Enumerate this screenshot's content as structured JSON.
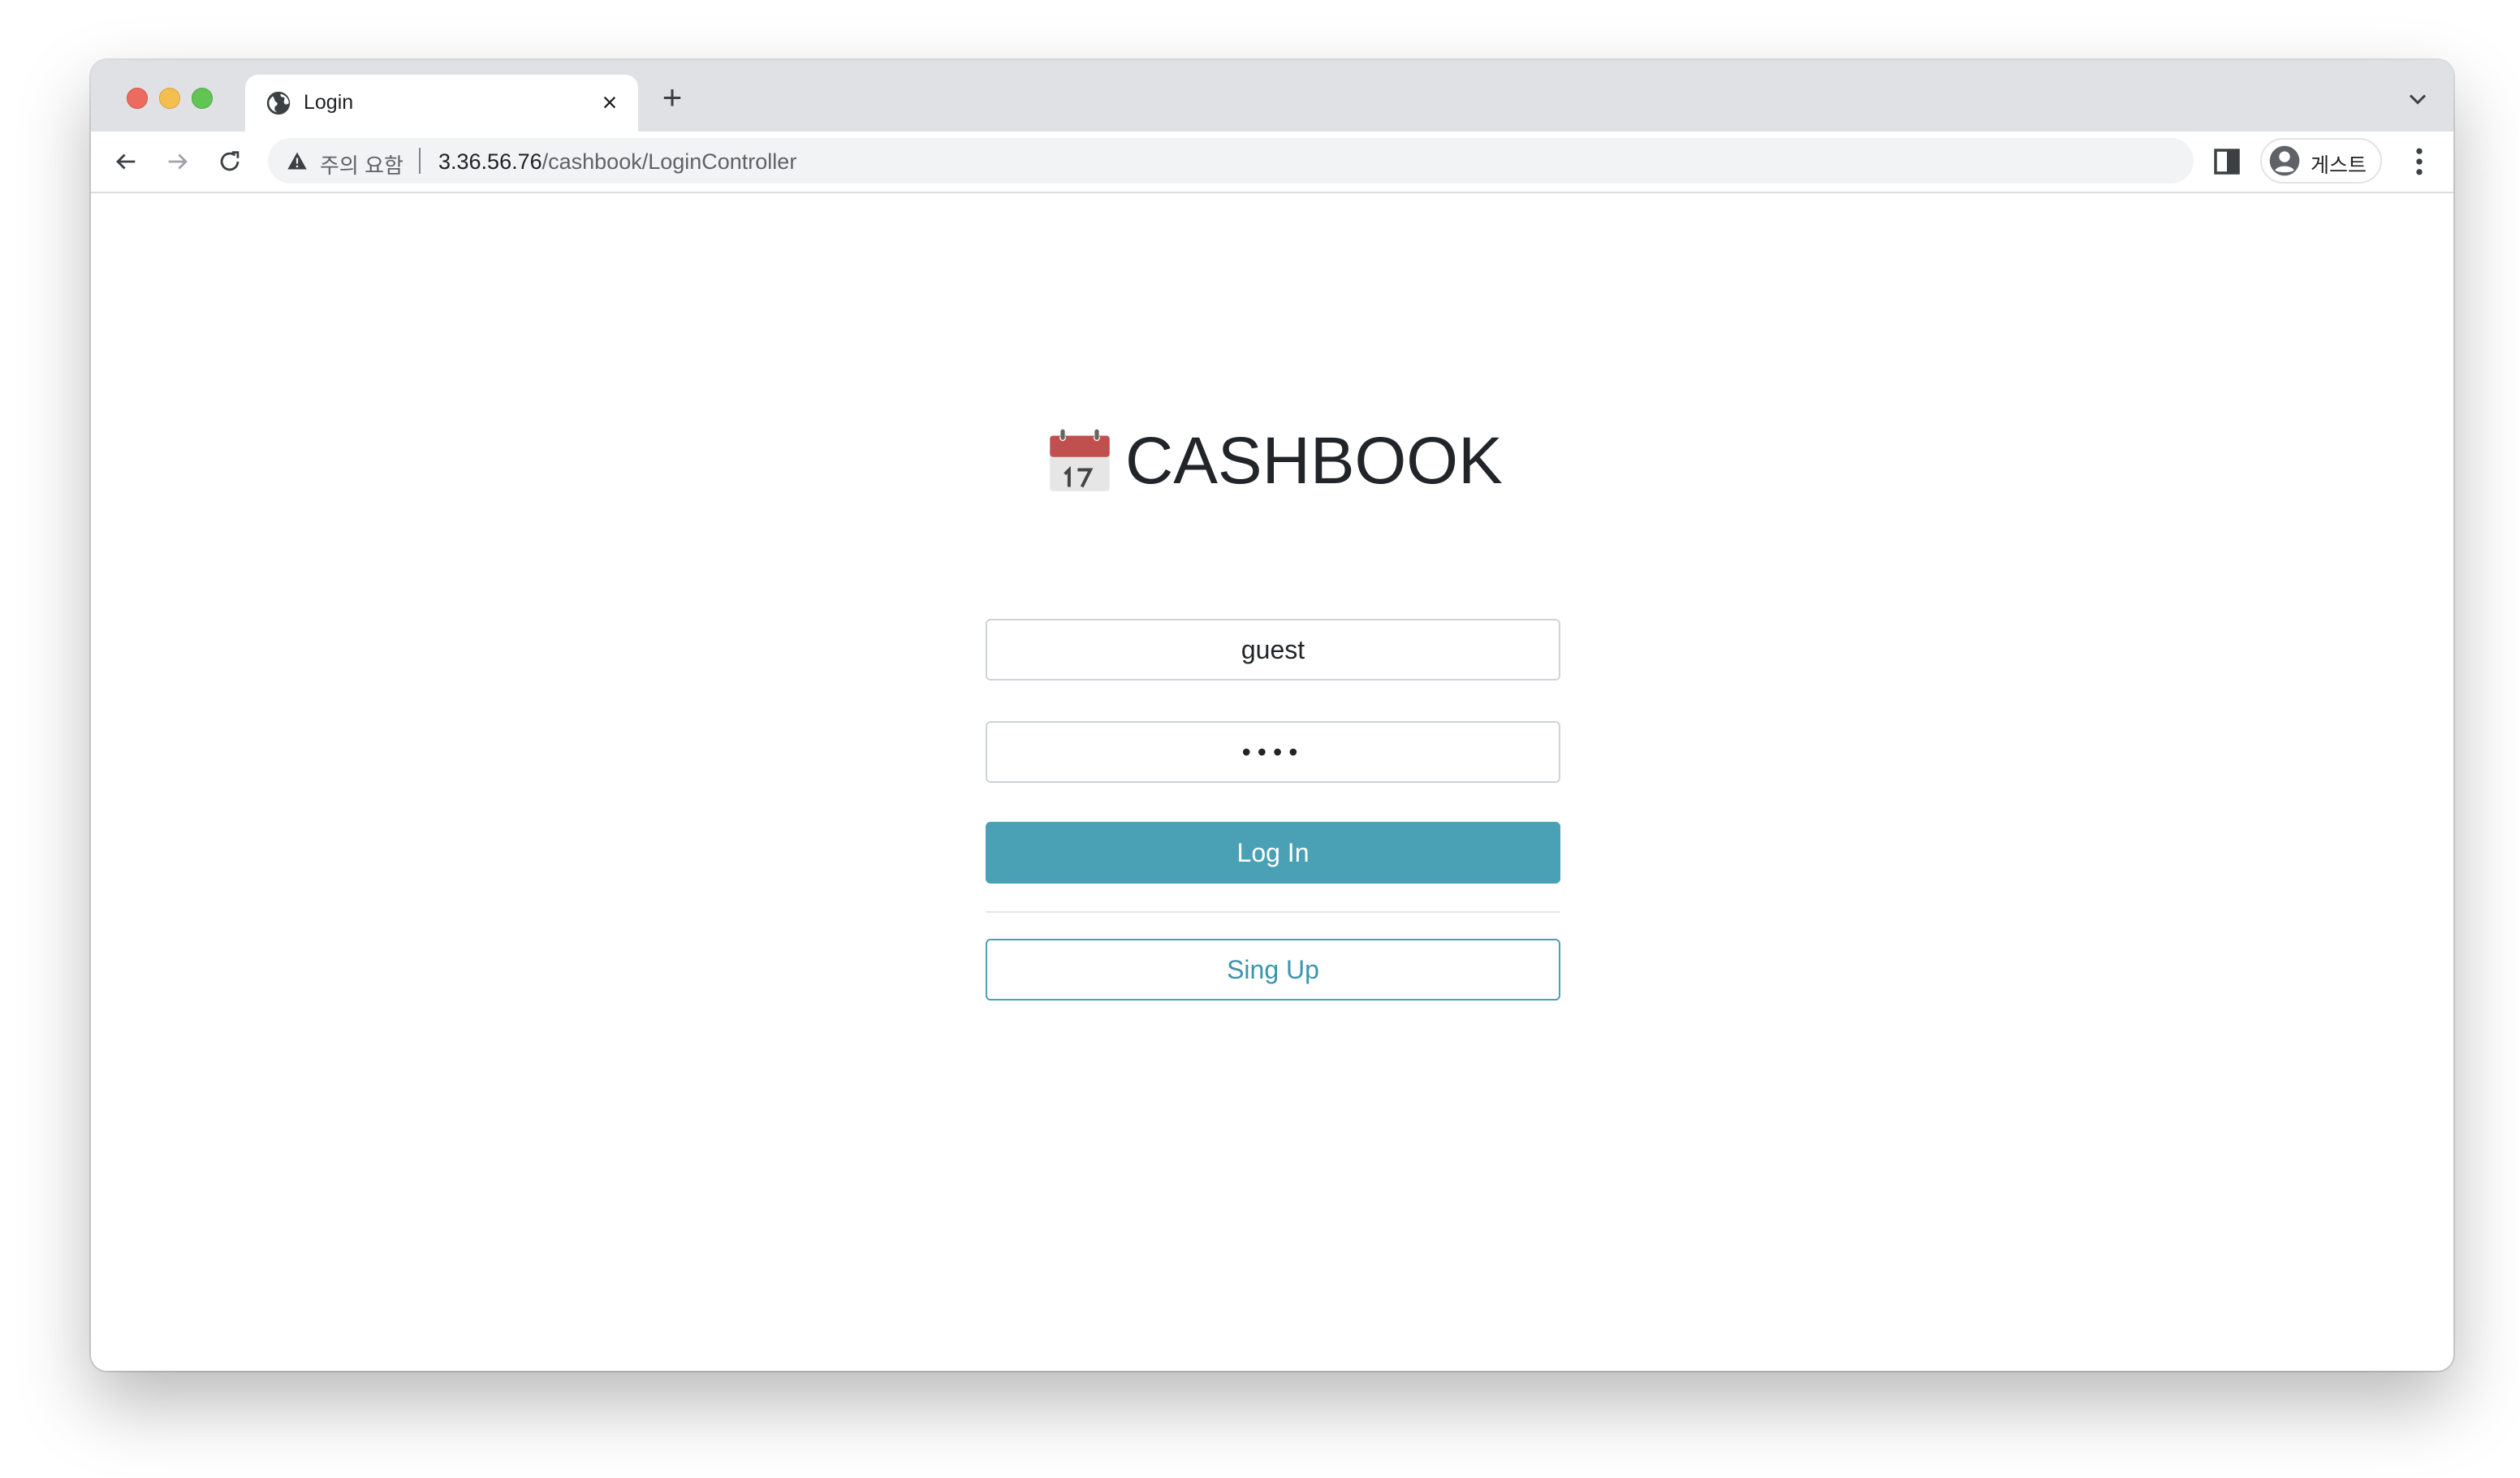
{
  "browser": {
    "tab": {
      "title": "Login",
      "close_label": "×"
    },
    "new_tab_label": "+",
    "address_bar": {
      "security_label": "주의 요함",
      "url_host": "3.36.56.76",
      "url_path": "/cashbook/LoginController"
    },
    "profile": {
      "name": "게스트"
    }
  },
  "page": {
    "brand_title": "CASHBOOK",
    "username_value": "guest",
    "password_value": "••••",
    "login_button_label": "Log In",
    "signup_button_label": "Sing Up"
  },
  "colors": {
    "primary": "#4aa0b5",
    "titlebar": "#dfe1e5",
    "omnibox": "#f1f3f4",
    "text": "#212529"
  }
}
